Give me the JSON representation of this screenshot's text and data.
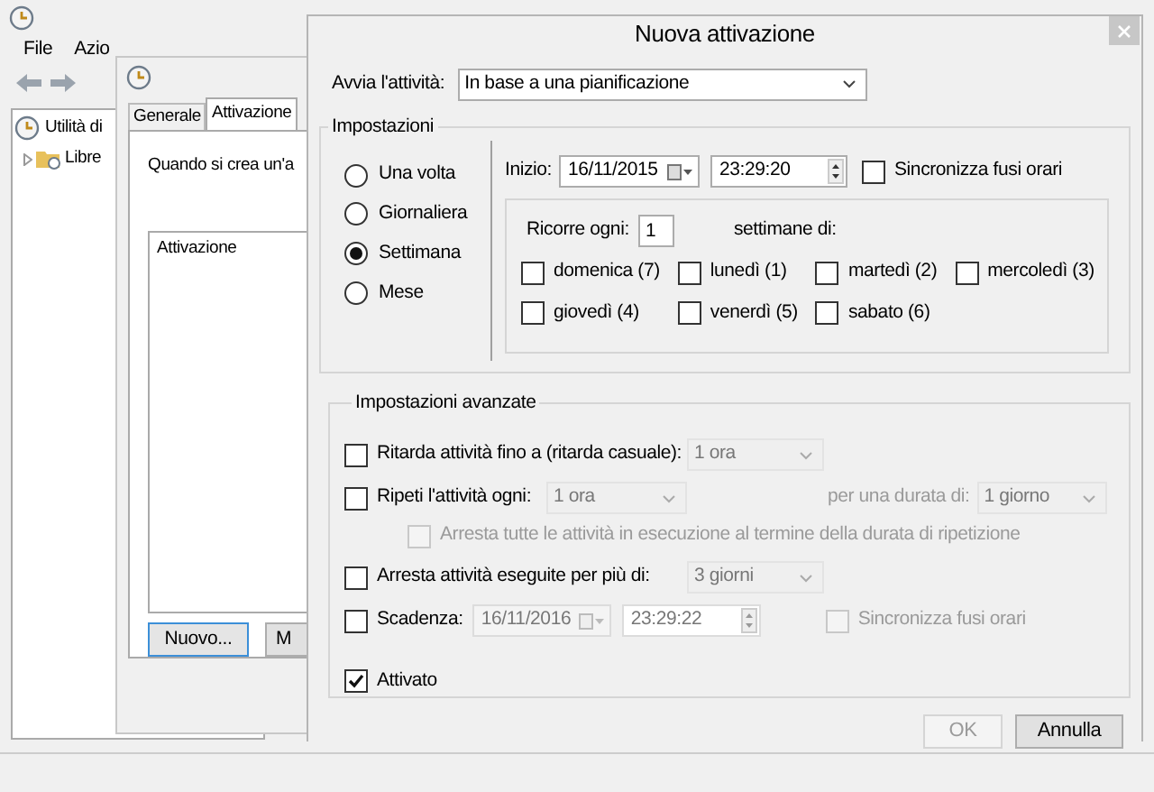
{
  "main_window": {
    "menu": [
      "File",
      "Azio"
    ],
    "tree": [
      {
        "label": "Utilità di",
        "children": [
          {
            "label": "Libre"
          }
        ]
      }
    ]
  },
  "properties_dialog": {
    "tabs": [
      {
        "label": "Generale",
        "selected": false
      },
      {
        "label": "Attivazione",
        "selected": true
      }
    ],
    "description": "Quando si crea un'a",
    "list_columns": [
      "Attivazione"
    ],
    "buttons": [
      "Nuovo...",
      "M"
    ]
  },
  "trigger_dialog": {
    "title": "Nuova attivazione",
    "start_task": {
      "label": "Avvia l'attività:",
      "value": "In base a una pianificazione"
    },
    "settings": {
      "title": "Impostazioni",
      "schedule_options": [
        {
          "label": "Una volta",
          "selected": false
        },
        {
          "label": "Giornaliera",
          "selected": false
        },
        {
          "label": "Settimana",
          "selected": true
        },
        {
          "label": "Mese",
          "selected": false
        }
      ],
      "start": {
        "label": "Inizio:",
        "date": "16/11/2015",
        "time": "23:29:20"
      },
      "sync_time_zones": {
        "label": "Sincronizza fusi orari",
        "checked": false
      },
      "recur": {
        "label": "Ricorre ogni:",
        "value": "1",
        "suffix": "settimane di:"
      },
      "days": [
        {
          "label": "domenica (7)",
          "checked": false
        },
        {
          "label": "lunedì (1)",
          "checked": false
        },
        {
          "label": "martedì (2)",
          "checked": false
        },
        {
          "label": "mercoledì (3)",
          "checked": false
        },
        {
          "label": "giovedì (4)",
          "checked": false
        },
        {
          "label": "venerdì (5)",
          "checked": false
        },
        {
          "label": "sabato (6)",
          "checked": false
        }
      ]
    },
    "advanced": {
      "title": "Impostazioni avanzate",
      "delay": {
        "label": "Ritarda attività fino a (ritarda casuale):",
        "checked": false,
        "value": "1 ora"
      },
      "repeat": {
        "label": "Ripeti l'attività ogni:",
        "checked": false,
        "value": "1 ora",
        "duration_label": "per una durata di:",
        "duration_value": "1 giorno"
      },
      "stop_all": {
        "label": "Arresta tutte le attività in esecuzione al termine della durata di ripetizione",
        "checked": false,
        "disabled": true
      },
      "stop_longer": {
        "label": "Arresta attività eseguite per più di:",
        "checked": false,
        "value": "3 giorni"
      },
      "expire": {
        "label": "Scadenza:",
        "checked": false,
        "date": "16/11/2016",
        "time": "23:29:22"
      },
      "expire_sync": {
        "label": "Sincronizza fusi orari",
        "checked": false,
        "disabled": true
      },
      "enabled": {
        "label": "Attivato",
        "checked": true
      }
    },
    "buttons": [
      {
        "label": "OK",
        "disabled": true
      },
      {
        "label": "Annulla",
        "disabled": false
      }
    ]
  }
}
